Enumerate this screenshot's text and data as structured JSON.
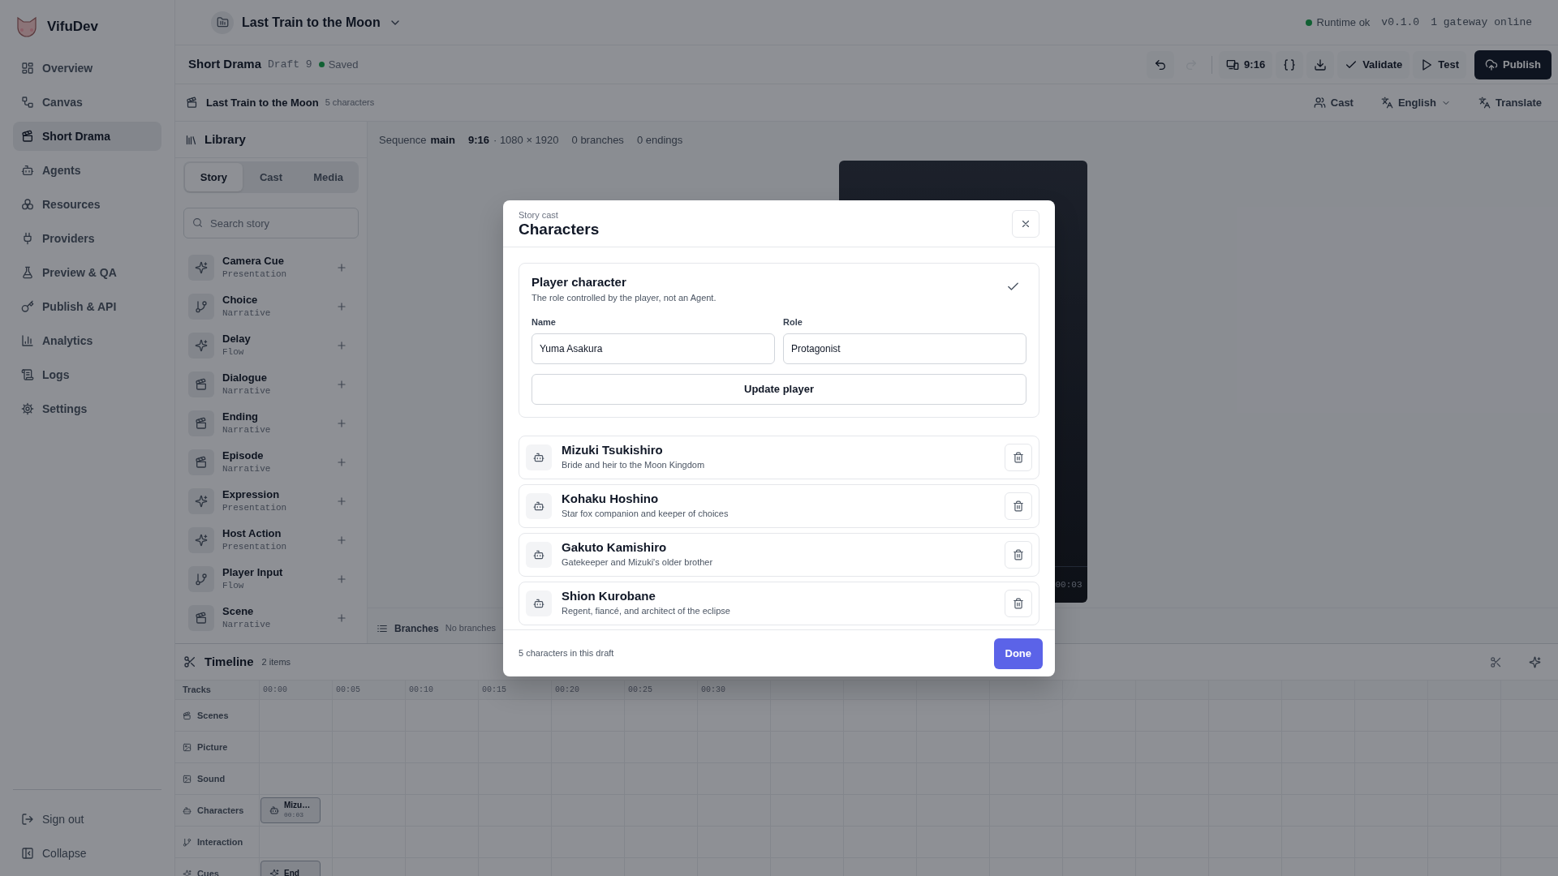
{
  "app": {
    "name": "VifuDev"
  },
  "nav": [
    {
      "label": "Overview",
      "selected": false
    },
    {
      "label": "Canvas",
      "selected": false
    },
    {
      "label": "Short Drama",
      "selected": true
    },
    {
      "label": "Agents",
      "selected": false
    },
    {
      "label": "Resources",
      "selected": false
    },
    {
      "label": "Providers",
      "selected": false
    },
    {
      "label": "Preview & QA",
      "selected": false
    },
    {
      "label": "Publish & API",
      "selected": false
    },
    {
      "label": "Analytics",
      "selected": false
    },
    {
      "label": "Logs",
      "selected": false
    },
    {
      "label": "Settings",
      "selected": false
    }
  ],
  "nav_footer": [
    {
      "label": "Sign out"
    },
    {
      "label": "Collapse"
    }
  ],
  "header": {
    "project_title": "Last Train to the Moon",
    "runtime_status": "Runtime ok",
    "version": "v0.1.0",
    "gateway": "1 gateway online"
  },
  "toolbar": {
    "section": "Short Drama",
    "draft": "Draft 9",
    "save_status": "Saved",
    "actions": [
      {
        "kind": "undo",
        "disabled": false
      },
      {
        "kind": "redo",
        "disabled": true
      },
      {
        "kind": "separator"
      },
      {
        "kind": "preview",
        "label": "9:16",
        "disabled": false
      },
      {
        "kind": "code",
        "disabled": false
      },
      {
        "kind": "export",
        "disabled": false
      },
      {
        "kind": "validate",
        "label": "Validate",
        "disabled": false
      },
      {
        "kind": "test",
        "label": "Test",
        "disabled": false
      },
      {
        "kind": "publish",
        "label": "Publish",
        "disabled": false
      }
    ]
  },
  "subbar": {
    "title": "Last Train to the Moon",
    "meta": "5 characters",
    "cast": "Cast",
    "language": "English",
    "translate": "Translate"
  },
  "library": {
    "title": "Library",
    "tabs": [
      {
        "label": "Story",
        "selected": true
      },
      {
        "label": "Cast",
        "selected": false
      },
      {
        "label": "Media",
        "selected": false
      }
    ],
    "search": {
      "placeholder": "Search story"
    },
    "items": [
      {
        "name": "Camera Cue",
        "category": "Presentation",
        "kind": "effect"
      },
      {
        "name": "Choice",
        "category": "Narrative",
        "kind": "branching"
      },
      {
        "name": "Delay",
        "category": "Flow",
        "kind": "effect"
      },
      {
        "name": "Dialogue",
        "category": "Narrative",
        "kind": "scene"
      },
      {
        "name": "Ending",
        "category": "Narrative",
        "kind": "scene"
      },
      {
        "name": "Episode",
        "category": "Narrative",
        "kind": "scene"
      },
      {
        "name": "Expression",
        "category": "Presentation",
        "kind": "effect"
      },
      {
        "name": "Host Action",
        "category": "Presentation",
        "kind": "effect"
      },
      {
        "name": "Player Input",
        "category": "Flow",
        "kind": "branching"
      },
      {
        "name": "Scene",
        "category": "Narrative",
        "kind": "scene"
      }
    ]
  },
  "canvas": {
    "sequence_label": "Sequence",
    "sequence": "main",
    "aspect": "9:16",
    "resolution": "· 1080 × 1920",
    "branches": "0 branches",
    "endings": "0 endings",
    "preview_time": "00:03",
    "branches_bar": {
      "title": "Branches",
      "status": "No branches"
    }
  },
  "timeline": {
    "title": "Timeline",
    "count": "2 items",
    "tracks_label": "Tracks",
    "ticks": [
      "00:00",
      "00:05",
      "00:10",
      "00:15",
      "00:20",
      "00:25",
      "00:30"
    ],
    "tracks": [
      {
        "label": "Scenes"
      },
      {
        "label": "Picture"
      },
      {
        "label": "Sound"
      },
      {
        "label": "Characters",
        "clips": [
          {
            "title": "Mizu…",
            "time": "00:03"
          }
        ]
      },
      {
        "label": "Interaction"
      },
      {
        "label": "Cues",
        "clips": [
          {
            "title": "End"
          }
        ]
      }
    ]
  },
  "dialog": {
    "eyebrow": "Story cast",
    "title": "Characters",
    "player": {
      "title": "Player character",
      "description": "The role controlled by the player, not an Agent.",
      "name_label": "Name",
      "name_value": "Yuma Asakura",
      "role_label": "Role",
      "role_value": "Protagonist",
      "button": "Update player"
    },
    "characters": [
      {
        "name": "Mizuki Tsukishiro",
        "description": "Bride and heir to the Moon Kingdom"
      },
      {
        "name": "Kohaku Hoshino",
        "description": "Star fox companion and keeper of choices"
      },
      {
        "name": "Gakuto Kamishiro",
        "description": "Gatekeeper and Mizuki's older brother"
      },
      {
        "name": "Shion Kurobane",
        "description": "Regent, fiancé, and architect of the eclipse"
      }
    ],
    "footer": "5 characters in this draft",
    "done": "Done"
  }
}
